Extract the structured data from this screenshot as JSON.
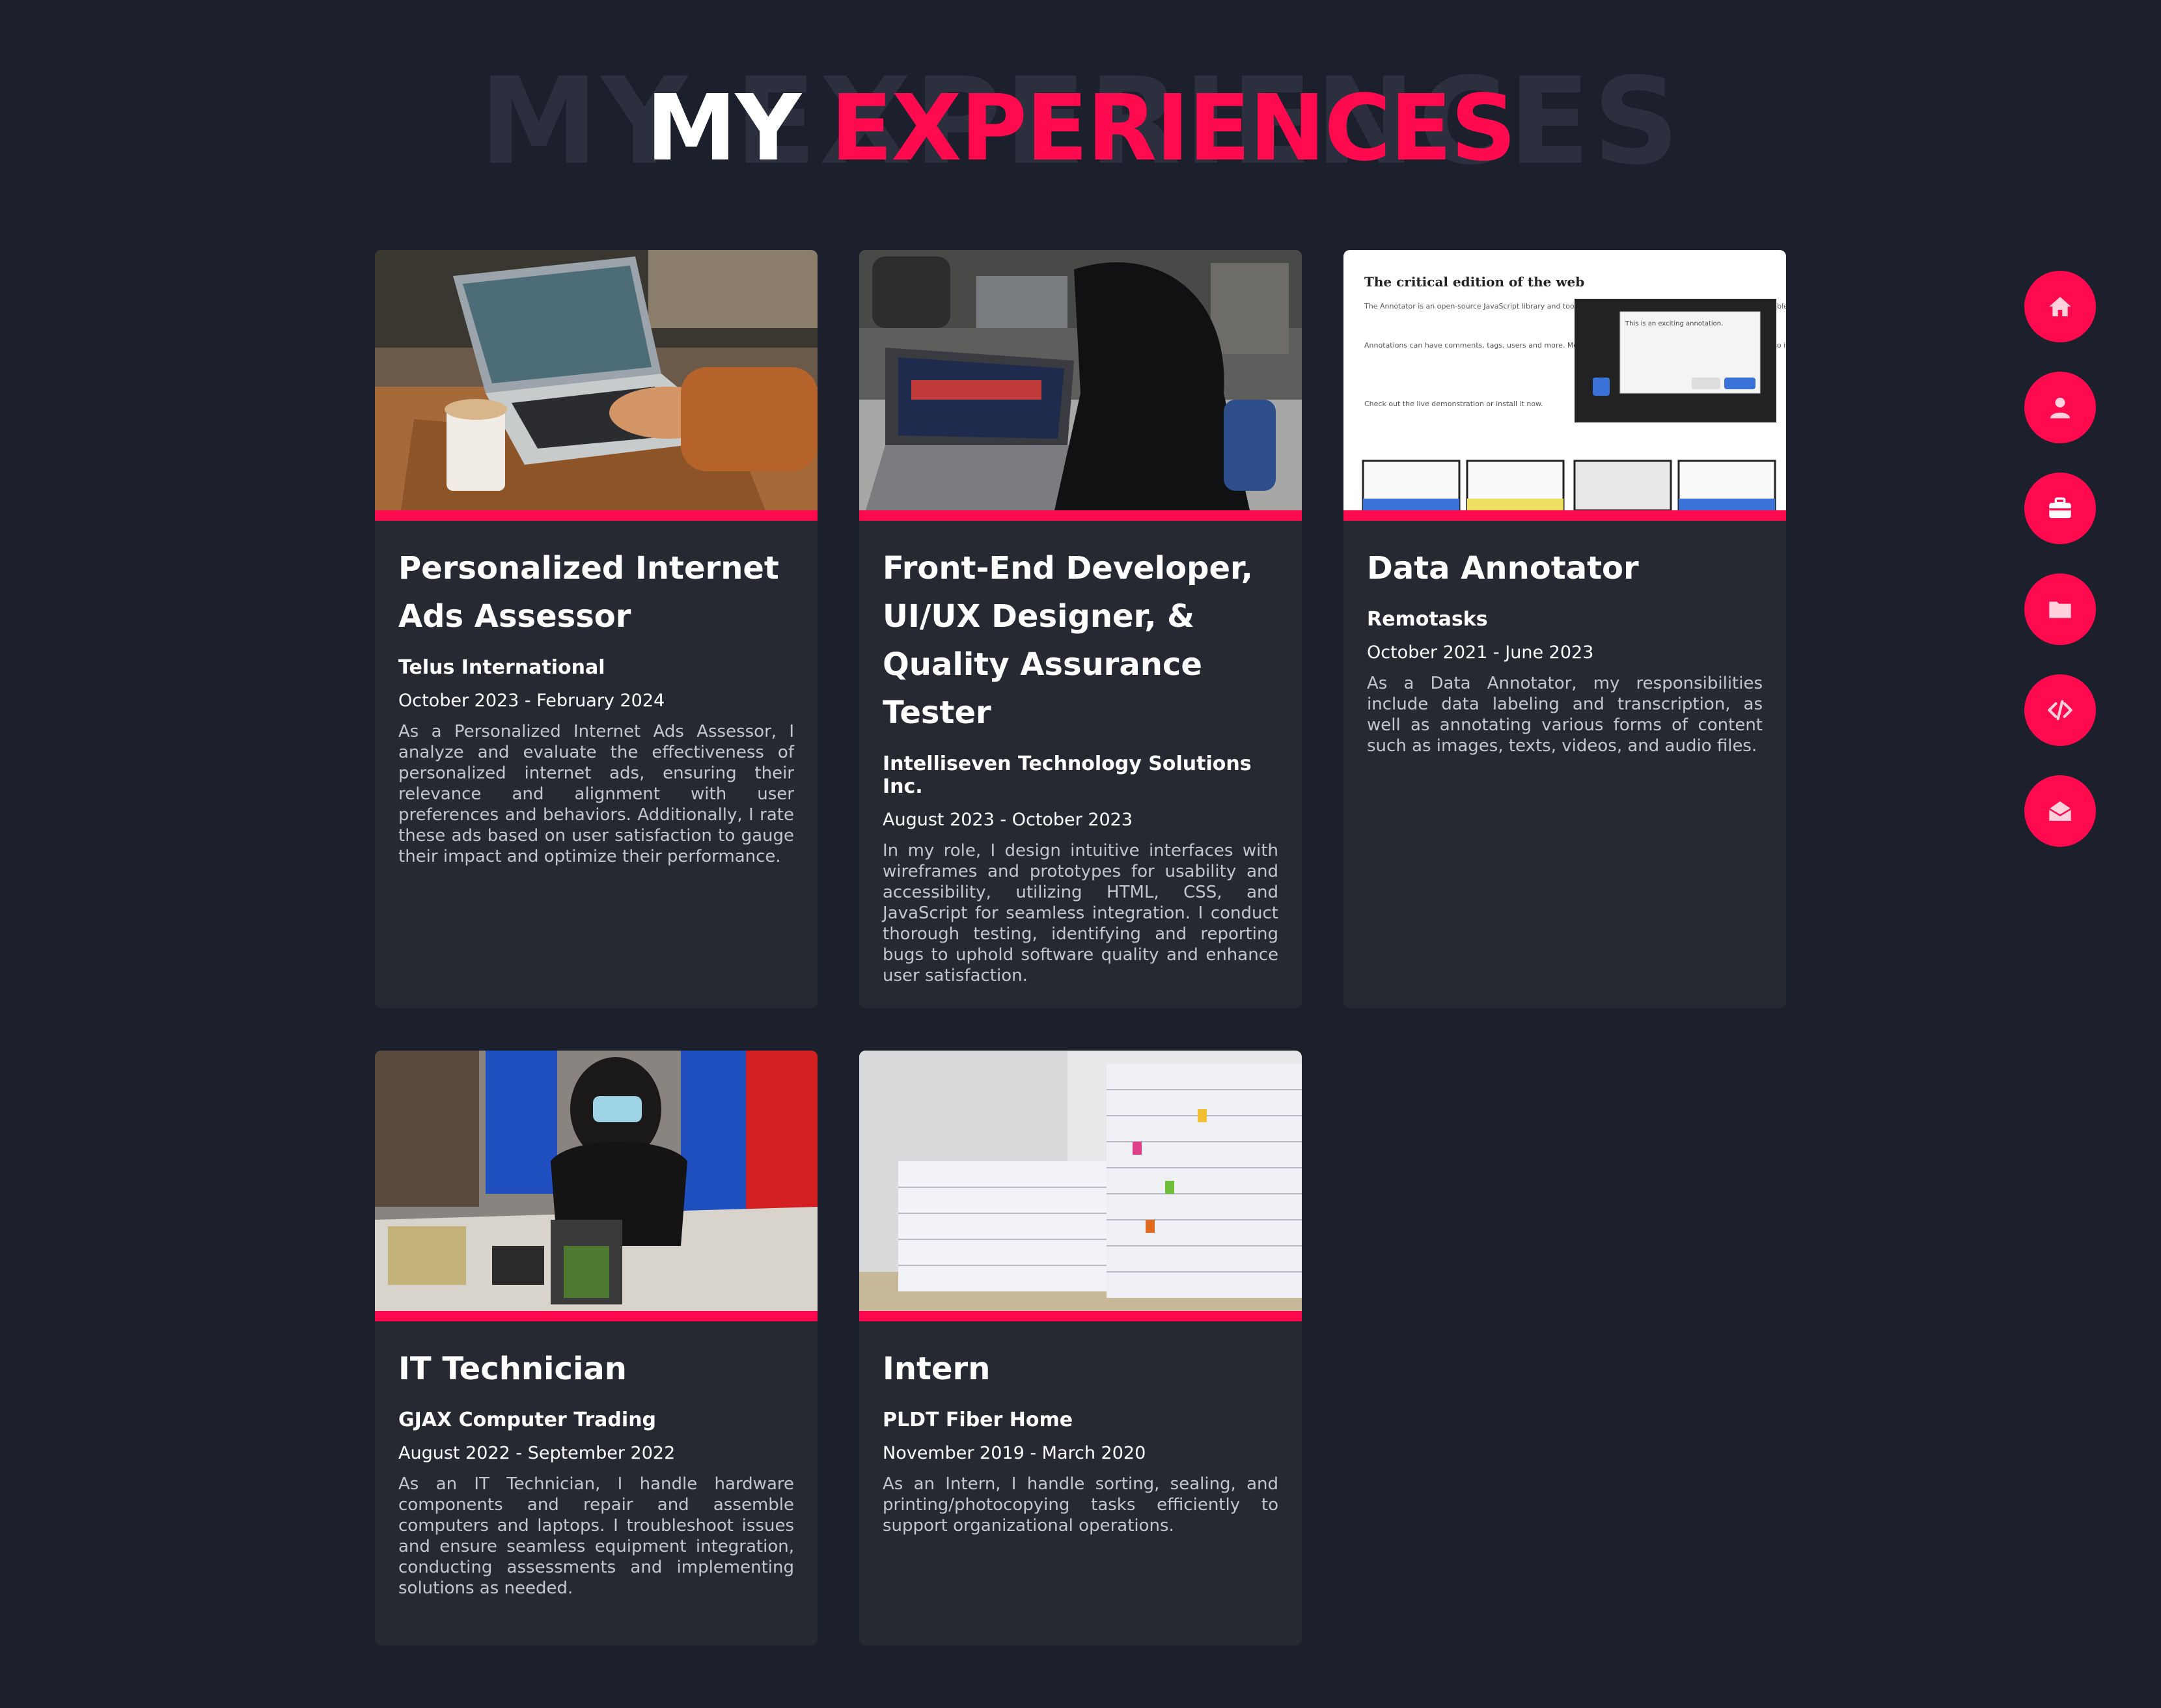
{
  "heading": {
    "background_text": "MY EXPERIENCES",
    "title_part1": "MY",
    "title_part2": "EXPERIENCES"
  },
  "experiences": [
    {
      "title": "Personalized Internet Ads Assessor",
      "company": "Telus International",
      "date": "October 2023 - February 2024",
      "description": "As a Personalized Internet Ads Assessor, I analyze and evaluate the effectiveness of personalized internet ads, ensuring their relevance and alignment with user preferences and behaviors. Additionally, I rate these ads based on user satisfaction to gauge their impact and optimize their performance."
    },
    {
      "title": "Front-End Developer, UI/UX Designer, & Quality Assurance Tester",
      "company": "Intelliseven Technology Solutions Inc.",
      "date": "August 2023 - October 2023",
      "description": "In my role, I design intuitive interfaces with wireframes and prototypes for usability and accessibility, utilizing HTML, CSS, and JavaScript for seamless integration. I conduct thorough testing, identifying and reporting bugs to uphold software quality and enhance user satisfaction."
    },
    {
      "title": "Data Annotator",
      "company": "Remotasks",
      "date": "October 2021 - June 2023",
      "description": "As a Data Annotator, my responsibilities include data labeling and transcription, as well as annotating various forms of content such as images, texts, videos, and audio files.",
      "image_texts": {
        "headline": "The critical edition of the web",
        "para1": "The Annotator is an open-source JavaScript library and tool that can be added to any webpage to make it annotatable.",
        "para2": "Annotations can have comments, tags, users and more. Morever, the Annotator is designed for easy extensibility so its a cinch to add a new feature or behaviour.",
        "para3": "Check out the live demonstration or install it now.",
        "popup": "This is an exciting annotation."
      }
    },
    {
      "title": "IT Technician",
      "company": "GJAX Computer Trading",
      "date": "August 2022 - September 2022",
      "description": "As an IT Technician, I handle hardware components and repair and assemble computers and laptops. I troubleshoot issues and ensure seamless equipment integration, conducting assessments and implementing solutions as needed."
    },
    {
      "title": "Intern",
      "company": "PLDT Fiber Home",
      "date": "November 2019 - March 2020",
      "description": "As an Intern, I handle sorting, sealing, and printing/photocopying tasks efficiently to support organizational operations."
    }
  ],
  "nav": [
    {
      "icon": "home-icon"
    },
    {
      "icon": "user-icon"
    },
    {
      "icon": "briefcase-icon"
    },
    {
      "icon": "folder-icon"
    },
    {
      "icon": "code-icon"
    },
    {
      "icon": "envelope-open-icon"
    }
  ],
  "colors": {
    "background": "#1c1f2c",
    "card": "#262932",
    "accent": "#ff0a4f"
  }
}
